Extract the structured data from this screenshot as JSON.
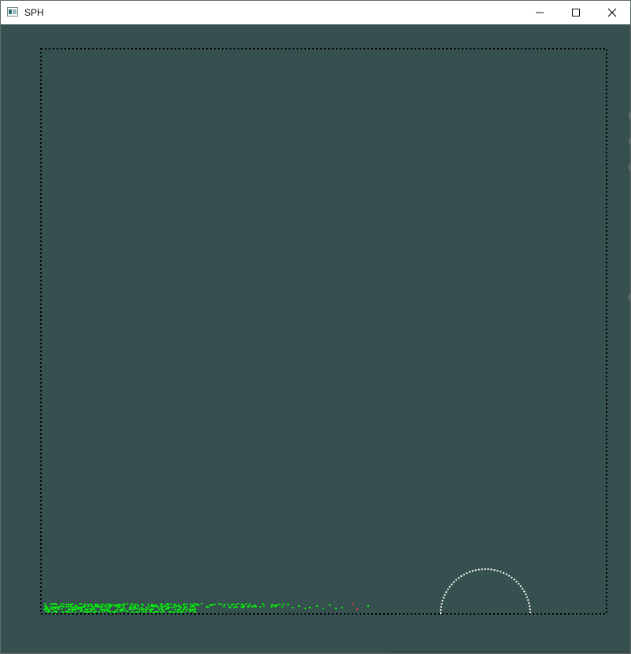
{
  "window": {
    "title": "SPH"
  },
  "icons": {
    "app": "app-window-icon",
    "minimize": "minimize-icon",
    "maximize": "maximize-icon",
    "close": "close-icon"
  },
  "scene": {
    "background_color": "#364f4f",
    "boundary_color": "#000000",
    "obstacle_color": "#ffffff",
    "particle_color_primary": "#00ff00",
    "particle_color_secondary": "#ff3333"
  }
}
